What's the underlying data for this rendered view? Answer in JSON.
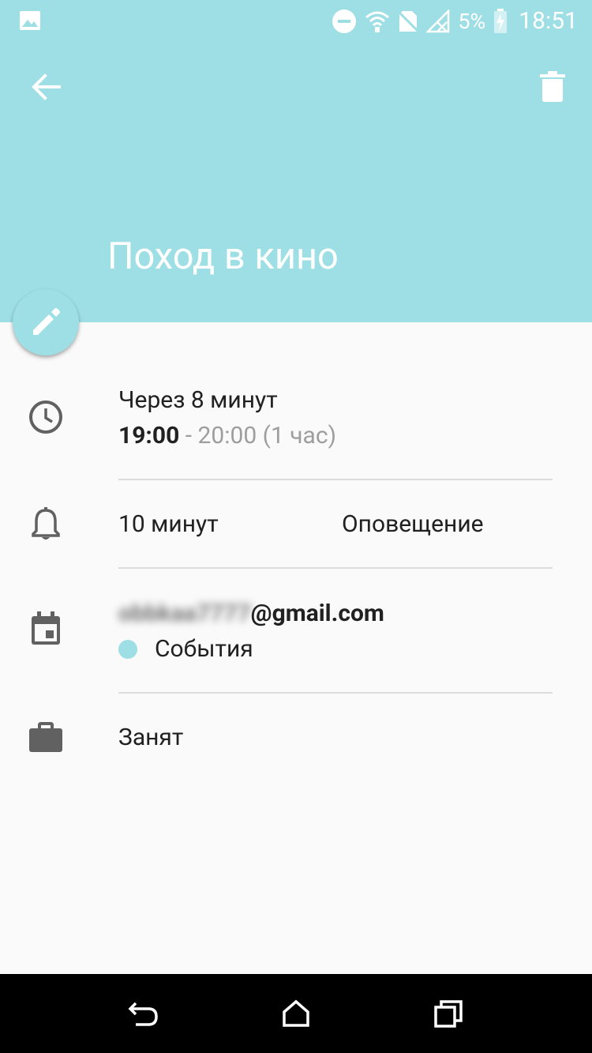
{
  "status_bar": {
    "battery_percent": "5%",
    "time": "18:51",
    "icons": [
      "gallery-icon",
      "do-not-disturb-icon",
      "wifi-icon",
      "no-sim-icon",
      "signal-off-icon",
      "battery-charging-icon"
    ]
  },
  "toolbar": {
    "back_icon": "arrow-back-icon",
    "delete_icon": "trash-icon"
  },
  "event": {
    "title": "Поход в кино",
    "relative_time": "Через 8 минут",
    "start_time": "19:00",
    "separator": " - ",
    "end_time": "20:00",
    "duration": "(1 час)"
  },
  "reminder": {
    "value": "10 минут",
    "type": "Оповещение"
  },
  "calendar": {
    "account_hidden": "obbkaa7777",
    "account_domain": "@gmail.com",
    "name": "События"
  },
  "availability": {
    "status": "Занят"
  },
  "colors": {
    "accent": "#9ddfe4",
    "background": "#fafafa",
    "text_primary": "#212121",
    "text_secondary": "#9e9e9e",
    "icon": "#616161"
  },
  "nav_bar": {
    "icons": [
      "back-nav-icon",
      "home-nav-icon",
      "recents-nav-icon"
    ]
  }
}
